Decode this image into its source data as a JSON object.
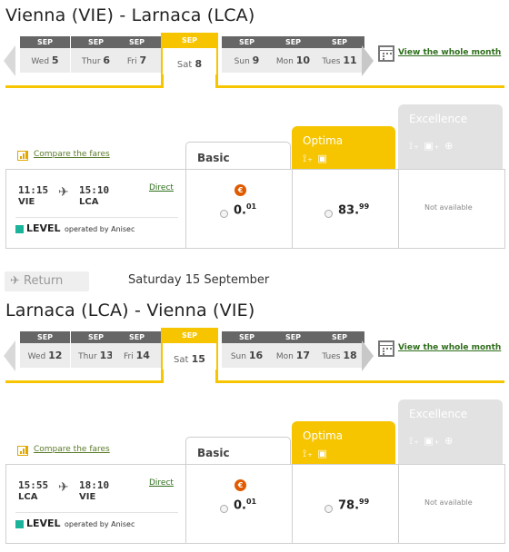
{
  "outbound": {
    "title": "Vienna (VIE) - Larnaca (LCA)",
    "days": [
      {
        "month": "SEP",
        "dow": "Wed",
        "num": "5"
      },
      {
        "month": "SEP",
        "dow": "Thur",
        "num": "6"
      },
      {
        "month": "SEP",
        "dow": "Fri",
        "num": "7"
      },
      {
        "month": "SEP",
        "dow": "Sat",
        "num": "8"
      },
      {
        "month": "SEP",
        "dow": "Sun",
        "num": "9"
      },
      {
        "month": "SEP",
        "dow": "Mon",
        "num": "10"
      },
      {
        "month": "SEP",
        "dow": "Tues",
        "num": "11"
      }
    ],
    "selected_index": 3,
    "view_month": "View the whole month",
    "compare": "Compare the fares",
    "fares": {
      "basic": "Basic",
      "optima": "Optima",
      "excellence": "Excellence"
    },
    "flight": {
      "dep_time": "11:15",
      "dep_apt": "VIE",
      "arr_time": "15:10",
      "arr_apt": "LCA",
      "direct": "Direct",
      "airline": "LEVEL",
      "operated": "operated by Anisec"
    },
    "prices": {
      "basic_main": "0.",
      "basic_cents": "01",
      "optima_main": "83.",
      "optima_cents": "99",
      "excellence": "Not available"
    }
  },
  "return_bar": {
    "button": "Return",
    "date": "Saturday 15 September"
  },
  "inbound": {
    "title": "Larnaca (LCA) - Vienna (VIE)",
    "days": [
      {
        "month": "SEP",
        "dow": "Wed",
        "num": "12"
      },
      {
        "month": "SEP",
        "dow": "Thur",
        "num": "13"
      },
      {
        "month": "SEP",
        "dow": "Fri",
        "num": "14"
      },
      {
        "month": "SEP",
        "dow": "Sat",
        "num": "15"
      },
      {
        "month": "SEP",
        "dow": "Sun",
        "num": "16"
      },
      {
        "month": "SEP",
        "dow": "Mon",
        "num": "17"
      },
      {
        "month": "SEP",
        "dow": "Tues",
        "num": "18"
      }
    ],
    "selected_index": 3,
    "view_month": "View the whole month",
    "compare": "Compare the fares",
    "fares": {
      "basic": "Basic",
      "optima": "Optima",
      "excellence": "Excellence"
    },
    "flight": {
      "dep_time": "15:55",
      "dep_apt": "LCA",
      "arr_time": "18:10",
      "arr_apt": "VIE",
      "direct": "Direct",
      "airline": "LEVEL",
      "operated": "operated by Anisec"
    },
    "prices": {
      "basic_main": "0.",
      "basic_cents": "01",
      "optima_main": "78.",
      "optima_cents": "99",
      "excellence": "Not available"
    }
  },
  "colors": {
    "accent": "#f6c500",
    "link": "#2f6e1c",
    "level": "#1bb39a",
    "promo": "#e05a00"
  }
}
